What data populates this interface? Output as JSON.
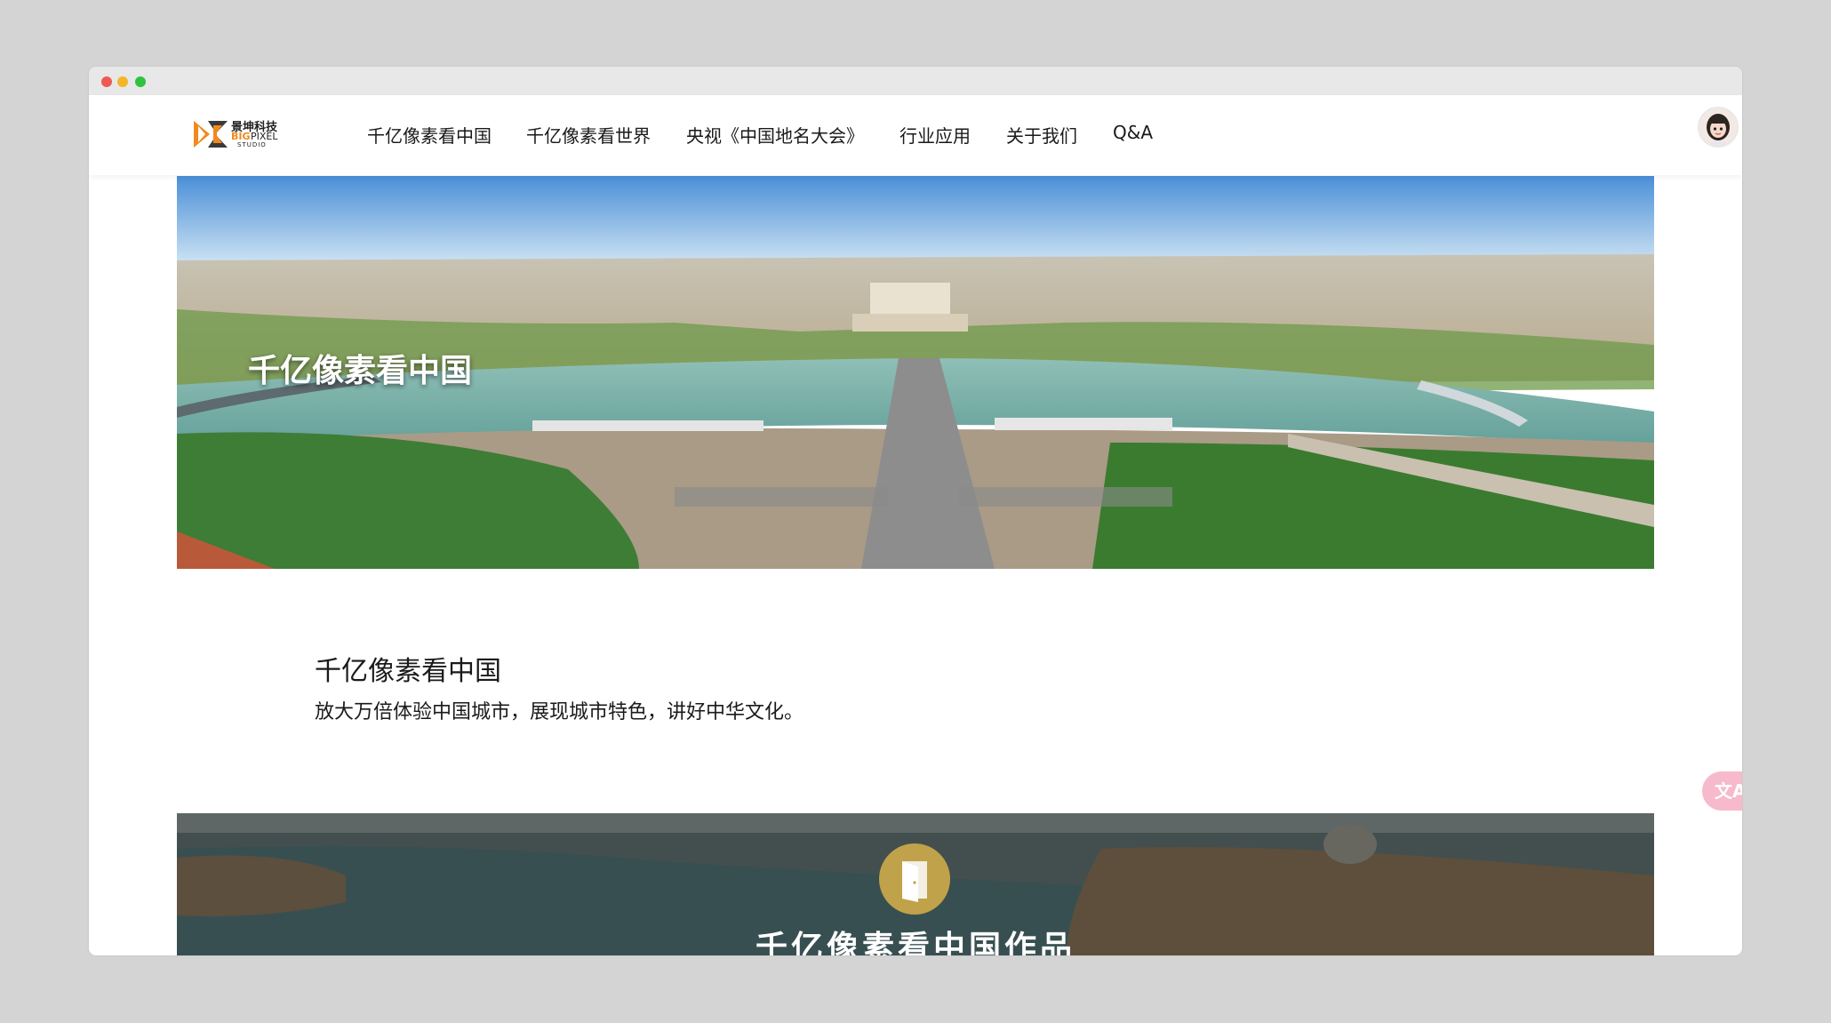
{
  "window": {
    "controls": [
      "close",
      "minimize",
      "maximize"
    ]
  },
  "header": {
    "logo": {
      "icon": "bigpixel-logo-icon",
      "brand_cn": "景坤科技",
      "brand_big": "BIG",
      "brand_pixel": "PIXEL",
      "brand_studio": "STUDIO"
    },
    "nav": [
      {
        "label": "千亿像素看中国"
      },
      {
        "label": "千亿像素看世界"
      },
      {
        "label": "央视《中国地名大会》"
      },
      {
        "label": "行业应用"
      },
      {
        "label": "关于我们"
      },
      {
        "label": "Q&A"
      }
    ],
    "avatar_icon": "user-avatar-icon"
  },
  "hero": {
    "title": "千亿像素看中国"
  },
  "intro": {
    "title": "千亿像素看中国",
    "description": "放大万倍体验中国城市，展现城市特色，讲好中华文化。"
  },
  "works_banner": {
    "icon": "door-icon",
    "title": "千亿像素看中国作品"
  },
  "translate_button": {
    "label": "文A",
    "icon": "translate-icon"
  },
  "colors": {
    "background": "#d4d4d4",
    "logo_orange": "#f08a1c",
    "door_gold": "#c0a24a",
    "translate_pink": "#f7b9cc"
  }
}
